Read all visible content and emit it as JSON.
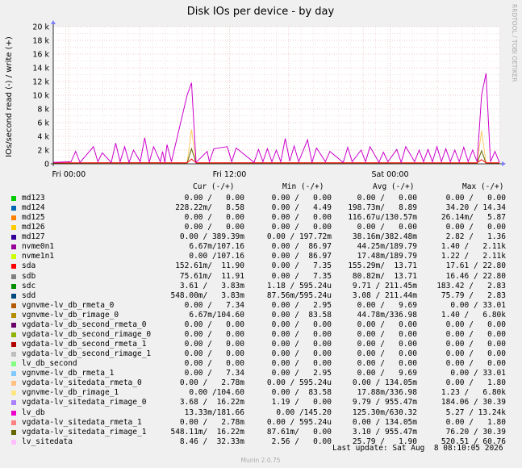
{
  "chart_data": {
    "type": "line",
    "title": "Disk IOs per device - by day",
    "ylabel": "IOs/second read (-) / write (+)",
    "watermark": "RRDTOOL / TOBI OETIKER",
    "footer": "Munin 2.0.75",
    "ylim": [
      0,
      20000
    ],
    "y_ticks": [
      "0",
      "2 k",
      "4 k",
      "6 k",
      "8 k",
      "10 k",
      "12 k",
      "14 k",
      "16 k",
      "18 k",
      "20 k"
    ],
    "x_ticks": [
      "Fri 00:00",
      "Fri 12:00",
      "Sat 00:00"
    ],
    "grid": true,
    "series": [
      {
        "name": "nvme0n1",
        "color": "#cc00cc",
        "x": [
          0.0,
          0.04,
          0.05,
          0.06,
          0.09,
          0.1,
          0.11,
          0.13,
          0.14,
          0.15,
          0.16,
          0.17,
          0.18,
          0.195,
          0.205,
          0.215,
          0.225,
          0.24,
          0.245,
          0.25,
          0.255,
          0.265,
          0.3,
          0.31,
          0.32,
          0.345,
          0.35,
          0.36,
          0.39,
          0.4,
          0.41,
          0.45,
          0.46,
          0.47,
          0.48,
          0.49,
          0.5,
          0.51,
          0.52,
          0.53,
          0.54,
          0.55,
          0.57,
          0.58,
          0.59,
          0.61,
          0.62,
          0.65,
          0.66,
          0.67,
          0.69,
          0.7,
          0.71,
          0.73,
          0.74,
          0.75,
          0.77,
          0.78,
          0.79,
          0.81,
          0.82,
          0.83,
          0.84,
          0.85,
          0.86,
          0.87,
          0.88,
          0.89,
          0.9,
          0.91,
          0.92,
          0.93,
          0.94,
          0.95,
          0.96,
          0.97,
          0.98,
          0.99,
          1.0
        ],
        "values": [
          200,
          300,
          1800,
          200,
          2500,
          300,
          1600,
          200,
          3000,
          300,
          2500,
          200,
          2000,
          300,
          3800,
          200,
          2500,
          300,
          1800,
          200,
          2800,
          300,
          10000,
          11800,
          200,
          1800,
          300,
          2200,
          2500,
          300,
          2300,
          200,
          2100,
          300,
          2200,
          300,
          2000,
          300,
          3700,
          400,
          2600,
          300,
          3500,
          200,
          2300,
          300,
          1800,
          200,
          2400,
          300,
          2000,
          300,
          2500,
          200,
          1700,
          300,
          2100,
          200,
          2500,
          300,
          2000,
          300,
          2100,
          300,
          2500,
          300,
          2200,
          300,
          2000,
          300,
          2400,
          300,
          2000,
          300,
          10000,
          13200,
          300,
          1800,
          200
        ]
      },
      {
        "name": "sda",
        "color": "#ff0000",
        "x": [
          0.0,
          0.3,
          0.31,
          0.32,
          0.9,
          0.95,
          0.96,
          0.97,
          1.0
        ],
        "values": [
          150,
          150,
          700,
          150,
          150,
          150,
          600,
          150,
          150
        ]
      },
      {
        "name": "vgdata-lv_sitedata_rimage_1",
        "color": "#666600",
        "x": [
          0.0,
          0.2,
          0.3,
          0.31,
          0.32,
          0.5,
          0.95,
          0.96,
          0.97,
          1.0
        ],
        "values": [
          100,
          150,
          120,
          2200,
          120,
          130,
          110,
          1900,
          110,
          100
        ]
      },
      {
        "name": "vgnvme-lv_db_rimage_1",
        "color": "#ffcc66",
        "x": [
          0.0,
          0.3,
          0.31,
          0.32,
          0.95,
          0.96,
          0.97,
          1.0
        ],
        "values": [
          80,
          80,
          5000,
          80,
          80,
          4800,
          80,
          80
        ]
      }
    ]
  },
  "legend": {
    "headers": {
      "cur": "Cur (-/+)",
      "min": "Min (-/+)",
      "avg": "Avg (-/+)",
      "max": "Max (-/+)"
    },
    "rows": [
      {
        "name": "md123",
        "color": "#00cc00",
        "cur": "0.00 /   0.00",
        "min": "0.00 /   0.00",
        "avg": "0.00 /   0.00",
        "max": "0.00 /   0.00"
      },
      {
        "name": "md124",
        "color": "#0066b3",
        "cur": "228.22m/   8.58",
        "min": "0.00 /   4.49",
        "avg": "198.73m/   8.89",
        "max": "34.20 / 14.34"
      },
      {
        "name": "md125",
        "color": "#ff8000",
        "cur": "0.00 /   0.00",
        "min": "0.00 /   0.00",
        "avg": "116.67u/130.57m",
        "max": "26.14m/   5.87"
      },
      {
        "name": "md126",
        "color": "#ffcc00",
        "cur": "0.00 /   0.00",
        "min": "0.00 /   0.00",
        "avg": "0.00 /   0.00",
        "max": "0.00 /   0.00"
      },
      {
        "name": "md127",
        "color": "#330099",
        "cur": "0.00 / 389.39m",
        "min": "0.00 / 197.72m",
        "avg": "38.16m/382.48m",
        "max": "2.82 /   1.36"
      },
      {
        "name": "nvme0n1",
        "color": "#990099",
        "cur": "6.67m/107.16",
        "min": "0.00 /  86.97",
        "avg": "44.25m/189.79",
        "max": "1.40 /   2.11k"
      },
      {
        "name": "nvme1n1",
        "color": "#ccff00",
        "cur": "0.00 /107.16",
        "min": "0.00 /  86.97",
        "avg": "17.48m/189.79",
        "max": "1.22 /   2.11k"
      },
      {
        "name": "sda",
        "color": "#ff0000",
        "cur": "152.61m/  11.90",
        "min": "0.00 /   7.35",
        "avg": "155.29m/  13.71",
        "max": "17.61 / 22.80"
      },
      {
        "name": "sdb",
        "color": "#808080",
        "cur": "75.61m/  11.91",
        "min": "0.00 /   7.35",
        "avg": "80.82m/  13.71",
        "max": "16.46 / 22.80"
      },
      {
        "name": "sdc",
        "color": "#008f00",
        "cur": "3.61 /   3.83m",
        "min": "1.18 / 595.24u",
        "avg": "9.71 / 211.45m",
        "max": "183.42 /   2.83"
      },
      {
        "name": "sdd",
        "color": "#00487d",
        "cur": "548.00m/   3.83m",
        "min": "87.56m/595.24u",
        "avg": "3.08 / 211.44m",
        "max": "75.79 /   2.83"
      },
      {
        "name": "vgnvme-lv_db_rmeta_0",
        "color": "#b35a00",
        "cur": "0.00 /   7.34",
        "min": "0.00 /   2.95",
        "avg": "0.00 /   9.69",
        "max": "0.00 / 33.01"
      },
      {
        "name": "vgnvme-lv_db_rimage_0",
        "color": "#b38f00",
        "cur": "6.67m/104.60",
        "min": "0.00 /  83.58",
        "avg": "44.78m/336.98",
        "max": "1.40 /   6.80k"
      },
      {
        "name": "vgdata-lv_db_second_rmeta_0",
        "color": "#6b006b",
        "cur": "0.00 /   0.00",
        "min": "0.00 /   0.00",
        "avg": "0.00 /   0.00",
        "max": "0.00 /   0.00"
      },
      {
        "name": "vgdata-lv_db_second_rimage_0",
        "color": "#8fb300",
        "cur": "0.00 /   0.00",
        "min": "0.00 /   0.00",
        "avg": "0.00 /   0.00",
        "max": "0.00 /   0.00"
      },
      {
        "name": "vgdata-lv_db_second_rmeta_1",
        "color": "#b30000",
        "cur": "0.00 /   0.00",
        "min": "0.00 /   0.00",
        "avg": "0.00 /   0.00",
        "max": "0.00 /   0.00"
      },
      {
        "name": "vgdata-lv_db_second_rimage_1",
        "color": "#bebebe",
        "cur": "0.00 /   0.00",
        "min": "0.00 /   0.00",
        "avg": "0.00 /   0.00",
        "max": "0.00 /   0.00"
      },
      {
        "name": "lv_db_second",
        "color": "#80ff80",
        "cur": "0.00 /   0.00",
        "min": "0.00 /   0.00",
        "avg": "0.00 /   0.00",
        "max": "0.00 /   0.00"
      },
      {
        "name": "vgnvme-lv_db_rmeta_1",
        "color": "#80c9ff",
        "cur": "0.00 /   7.34",
        "min": "0.00 /   2.95",
        "avg": "0.00 /   9.69",
        "max": "0.00 / 33.01"
      },
      {
        "name": "vgdata-lv_sitedata_rmeta_0",
        "color": "#ffc080",
        "cur": "0.00 /   2.78m",
        "min": "0.00 / 595.24u",
        "avg": "0.00 / 134.05m",
        "max": "0.00 /   1.80"
      },
      {
        "name": "vgnvme-lv_db_rimage_1",
        "color": "#ffe680",
        "cur": "0.00 /104.60",
        "min": "0.00 /  83.58",
        "avg": "17.88m/336.98",
        "max": "1.23 /   6.80k"
      },
      {
        "name": "vgdata-lv_sitedata_rimage_0",
        "color": "#aa80ff",
        "cur": "3.68 /  16.22m",
        "min": "1.19 /   0.00",
        "avg": "9.79 / 955.47m",
        "max": "184.06 / 30.39"
      },
      {
        "name": "lv_db",
        "color": "#ee00cc",
        "cur": "13.33m/181.66",
        "min": "0.00 /145.20",
        "avg": "125.30m/630.32",
        "max": "5.27 / 13.24k"
      },
      {
        "name": "vgdata-lv_sitedata_rmeta_1",
        "color": "#ff8080",
        "cur": "0.00 /   2.78m",
        "min": "0.00 / 595.24u",
        "avg": "0.00 / 134.05m",
        "max": "0.00 /   1.80"
      },
      {
        "name": "vgdata-lv_sitedata_rimage_1",
        "color": "#666600",
        "cur": "548.11m/  16.22m",
        "min": "87.61m/   0.00",
        "avg": "3.10 / 955.47m",
        "max": "76.20 / 30.39"
      },
      {
        "name": "lv_sitedata",
        "color": "#ffbfff",
        "cur": "8.46 /  32.33m",
        "min": "2.56 /   0.00",
        "avg": "25.79 /   1.90",
        "max": "520.51 / 60.76"
      }
    ],
    "last_update": "Last update: Sat Aug  8 08:10:05 2026"
  }
}
